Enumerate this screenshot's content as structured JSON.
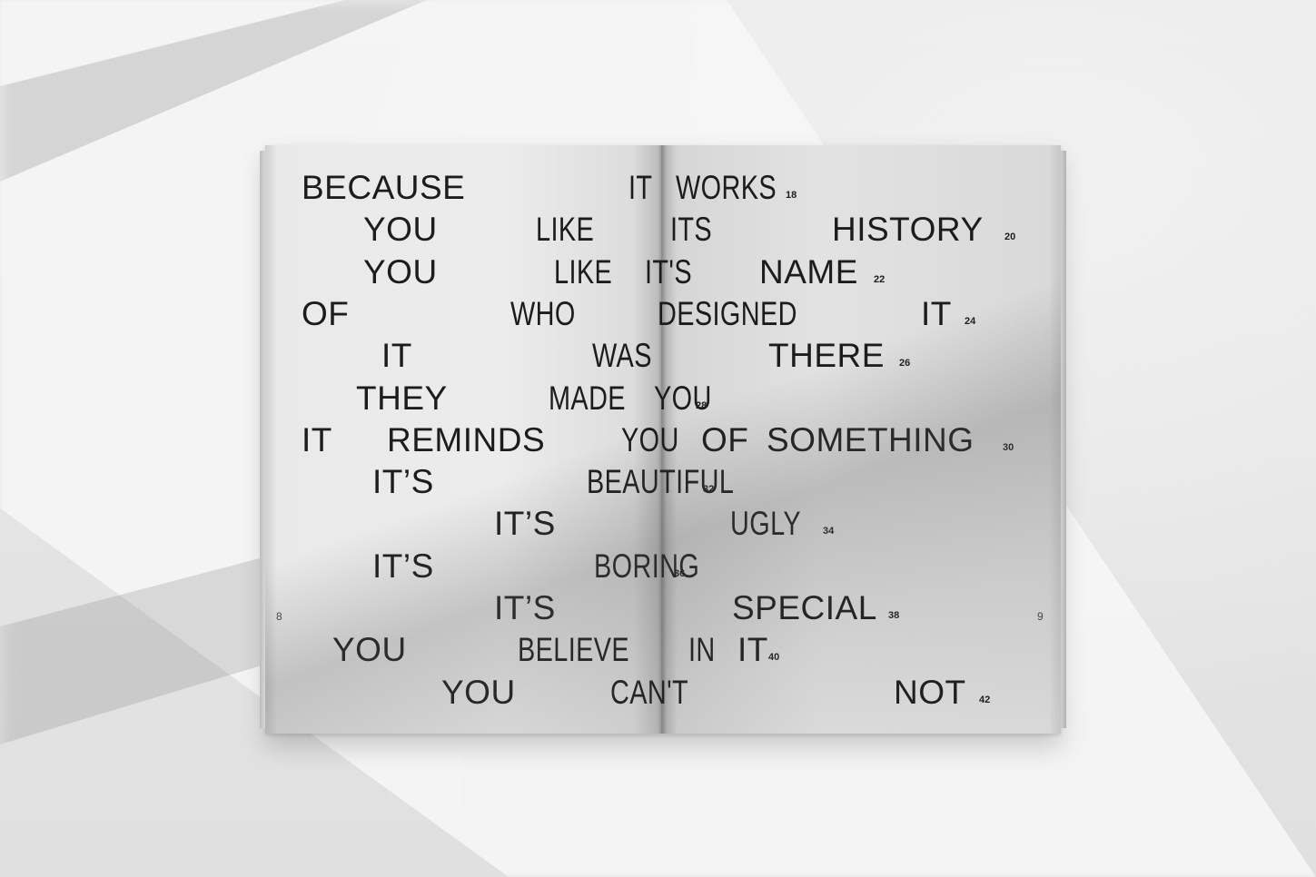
{
  "spread": {
    "page_left": "8",
    "page_right": "9",
    "lines": [
      {
        "words": [
          "BECAUSE",
          "IT",
          "WORKS"
        ],
        "number": "18"
      },
      {
        "words": [
          "YOU",
          "LIKE",
          "ITS",
          "HISTORY"
        ],
        "number": "20"
      },
      {
        "words": [
          "YOU",
          "LIKE",
          "IT'S",
          "NAME"
        ],
        "number": "22"
      },
      {
        "words": [
          "OF",
          "WHO",
          "DESIGNED",
          "IT"
        ],
        "number": "24"
      },
      {
        "words": [
          "IT",
          "WAS",
          "THERE"
        ],
        "number": "26"
      },
      {
        "words": [
          "THEY",
          "MADE",
          "YOU"
        ],
        "number": "28"
      },
      {
        "words": [
          "IT",
          "REMINDS",
          "YOU",
          "OF",
          "SOMETHING"
        ],
        "number": "30"
      },
      {
        "words": [
          "IT’S",
          "BEAUTIFUL"
        ],
        "number": "32"
      },
      {
        "words": [
          "IT’S",
          "UGLY"
        ],
        "number": "34"
      },
      {
        "words": [
          "IT’S",
          "BORING"
        ],
        "number": "36"
      },
      {
        "words": [
          "IT’S",
          "SPECIAL"
        ],
        "number": "38"
      },
      {
        "words": [
          "YOU",
          "BELIEVE",
          "IN",
          "IT"
        ],
        "number": "40"
      },
      {
        "words": [
          "YOU",
          "CAN'T",
          "NOT"
        ],
        "number": "42"
      }
    ]
  }
}
